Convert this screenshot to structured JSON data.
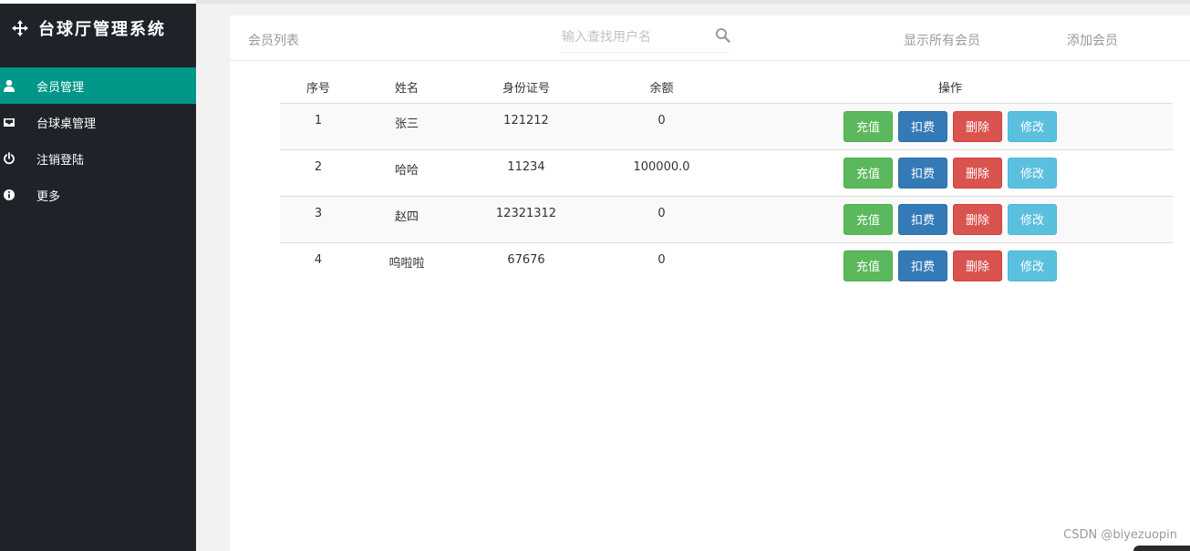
{
  "app": {
    "title": "台球厅管理系统"
  },
  "sidebar": {
    "items": [
      {
        "label": "会员管理",
        "icon": "user-icon",
        "active": true
      },
      {
        "label": "台球桌管理",
        "icon": "inbox-icon",
        "active": false
      },
      {
        "label": "注销登陆",
        "icon": "power-icon",
        "active": false
      },
      {
        "label": "更多",
        "icon": "info-icon",
        "active": false
      }
    ]
  },
  "header": {
    "title": "会员列表",
    "search_placeholder": "输入查找用户名",
    "search_value": "",
    "show_all_label": "显示所有会员",
    "add_member_label": "添加会员"
  },
  "table": {
    "columns": [
      "序号",
      "姓名",
      "身份证号",
      "余额",
      "操作"
    ],
    "rows": [
      [
        "1",
        "张三",
        "121212",
        "0"
      ],
      [
        "2",
        "哈哈",
        "11234",
        "100000.0"
      ],
      [
        "3",
        "赵四",
        "12321312",
        "0"
      ],
      [
        "4",
        "呜啦啦",
        "67676",
        "0"
      ]
    ],
    "actions": {
      "recharge": "充值",
      "deduct": "扣费",
      "delete": "删除",
      "edit": "修改"
    }
  },
  "watermark": "CSDN @biyezuopin",
  "colors": {
    "sidebar_bg": "#1f2229",
    "active_item": "#009688",
    "recharge": "#5cb85c",
    "deduct": "#337ab7",
    "delete": "#d9534f",
    "edit": "#5bc0de"
  }
}
